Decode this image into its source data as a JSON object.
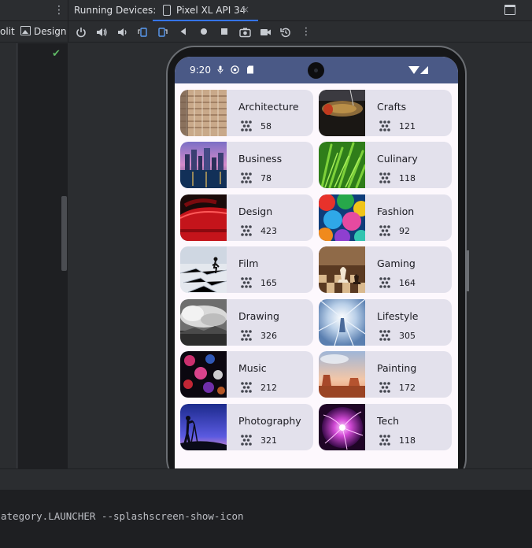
{
  "toolbar_top": {
    "kebab_icon": "more-vertical-icon",
    "panel_title": "Running Devices:",
    "device_tab": {
      "label": "Pixel XL API 34",
      "close": "×",
      "icon": "phone-icon"
    },
    "window_icon": "window-maximize-icon"
  },
  "toolbar": {
    "split_label": "olit",
    "design_label": "Design",
    "buttons": [
      "power-icon",
      "volume-up-icon",
      "volume-down-icon",
      "rotate-left-icon",
      "rotate-right-icon",
      "back-icon",
      "home-icon",
      "overview-icon",
      "screenshot-icon",
      "screen-record-icon",
      "snapshot-icon",
      "more-vertical-icon"
    ]
  },
  "device": {
    "status_bar": {
      "time": "9:20",
      "color": "#4a5986"
    },
    "categories": [
      {
        "name": "Architecture",
        "count": "58"
      },
      {
        "name": "Crafts",
        "count": "121"
      },
      {
        "name": "Business",
        "count": "78"
      },
      {
        "name": "Culinary",
        "count": "118"
      },
      {
        "name": "Design",
        "count": "423"
      },
      {
        "name": "Fashion",
        "count": "92"
      },
      {
        "name": "Film",
        "count": "165"
      },
      {
        "name": "Gaming",
        "count": "164"
      },
      {
        "name": "Drawing",
        "count": "326"
      },
      {
        "name": "Lifestyle",
        "count": "305"
      },
      {
        "name": "Music",
        "count": "212"
      },
      {
        "name": "Painting",
        "count": "172"
      },
      {
        "name": "Photography",
        "count": "321"
      },
      {
        "name": "Tech",
        "count": "118"
      }
    ]
  },
  "terminal": {
    "line": "ategory.LAUNCHER --splashscreen-show-icon"
  },
  "colors": {
    "ide_bg": "#2b2d30",
    "editor_bg": "#1e1f22",
    "card_bg": "#e3e1ec",
    "screen_bg": "#fdf8fd",
    "accent": "#3574f0",
    "check": "#5fb865"
  }
}
